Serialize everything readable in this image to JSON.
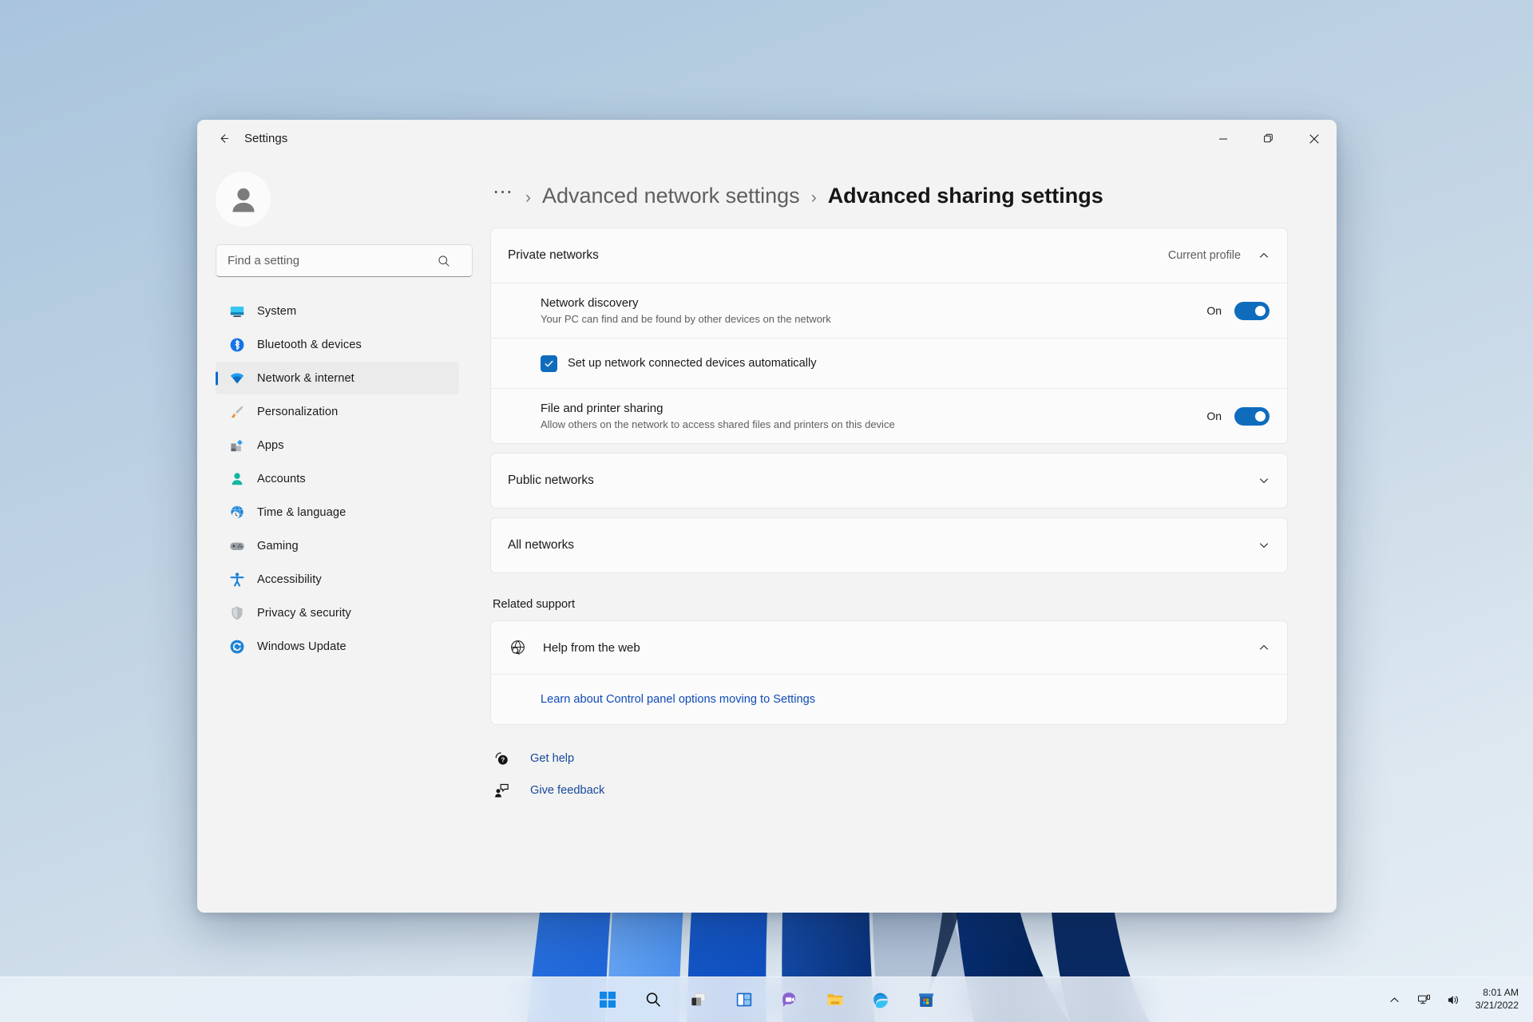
{
  "window": {
    "titlebar_title": "Settings",
    "back_icon": "arrow-left-icon",
    "minimize_label": "─",
    "maximize_label": "maximize-icon",
    "close_label": "✕"
  },
  "sidebar": {
    "avatar_icon": "person-avatar-icon",
    "search": {
      "placeholder": "Find a setting",
      "value": "",
      "icon": "search-icon"
    },
    "items": [
      {
        "label": "System",
        "icon": "system-monitor-icon",
        "active": false
      },
      {
        "label": "Bluetooth & devices",
        "icon": "bluetooth-icon",
        "active": false
      },
      {
        "label": "Network & internet",
        "icon": "wifi-icon",
        "active": true
      },
      {
        "label": "Personalization",
        "icon": "paintbrush-icon",
        "active": false
      },
      {
        "label": "Apps",
        "icon": "apps-blocks-icon",
        "active": false
      },
      {
        "label": "Accounts",
        "icon": "account-person-icon",
        "active": false
      },
      {
        "label": "Time & language",
        "icon": "clock-globe-icon",
        "active": false
      },
      {
        "label": "Gaming",
        "icon": "gamepad-icon",
        "active": false
      },
      {
        "label": "Accessibility",
        "icon": "accessibility-icon",
        "active": false
      },
      {
        "label": "Privacy & security",
        "icon": "shield-icon",
        "active": false
      },
      {
        "label": "Windows Update",
        "icon": "update-refresh-icon",
        "active": false
      }
    ]
  },
  "breadcrumb": {
    "ellipsis": "⋯",
    "separator": "›",
    "crumb1": "Advanced network settings",
    "crumb2": "Advanced sharing settings"
  },
  "main": {
    "private_networks": {
      "title": "Private networks",
      "profile_label": "Current profile",
      "chevron": "chevron-up-icon",
      "expanded": true,
      "rows": [
        {
          "title": "Network discovery",
          "subtitle": "Your PC can find and be found by other devices on the network",
          "toggle_label": "On",
          "toggle_on": true
        },
        {
          "title": "File and printer sharing",
          "subtitle": "Allow others on the network to access shared files and printers on this device",
          "toggle_label": "On",
          "toggle_on": true
        }
      ],
      "checkbox": {
        "label": "Set up network connected devices automatically",
        "checked": true
      }
    },
    "public_networks": {
      "title": "Public networks",
      "chevron": "chevron-down-icon",
      "expanded": false
    },
    "all_networks": {
      "title": "All networks",
      "chevron": "chevron-down-icon",
      "expanded": false
    },
    "related_support": {
      "heading": "Related support",
      "help_from_web": {
        "title": "Help from the web",
        "icon": "globe-help-icon",
        "chevron": "chevron-up-icon",
        "link": "Learn about Control panel options moving to Settings"
      }
    },
    "footer": {
      "get_help": {
        "label": "Get help",
        "icon": "get-help-icon"
      },
      "give_feedback": {
        "label": "Give feedback",
        "icon": "give-feedback-icon"
      }
    }
  },
  "taskbar": {
    "icons": [
      {
        "name": "start-icon",
        "label": "Start"
      },
      {
        "name": "search-icon",
        "label": "Search"
      },
      {
        "name": "task-view-icon",
        "label": "Task view"
      },
      {
        "name": "widgets-icon",
        "label": "Widgets"
      },
      {
        "name": "chat-teams-icon",
        "label": "Chat"
      },
      {
        "name": "file-explorer-icon",
        "label": "File Explorer"
      },
      {
        "name": "edge-icon",
        "label": "Microsoft Edge"
      },
      {
        "name": "microsoft-store-icon",
        "label": "Microsoft Store"
      }
    ],
    "tray": {
      "chevron_up": "chevron-up-icon",
      "network": "network-icon",
      "volume": "volume-icon",
      "time": "8:01 AM",
      "date": "3/21/2022"
    }
  },
  "colors": {
    "accent": "#0f6cbd",
    "link": "#0f4bb5",
    "card_bg": "#fbfbfb",
    "window_bg": "#f3f3f3",
    "selection_bar": "#0d6cc7"
  }
}
